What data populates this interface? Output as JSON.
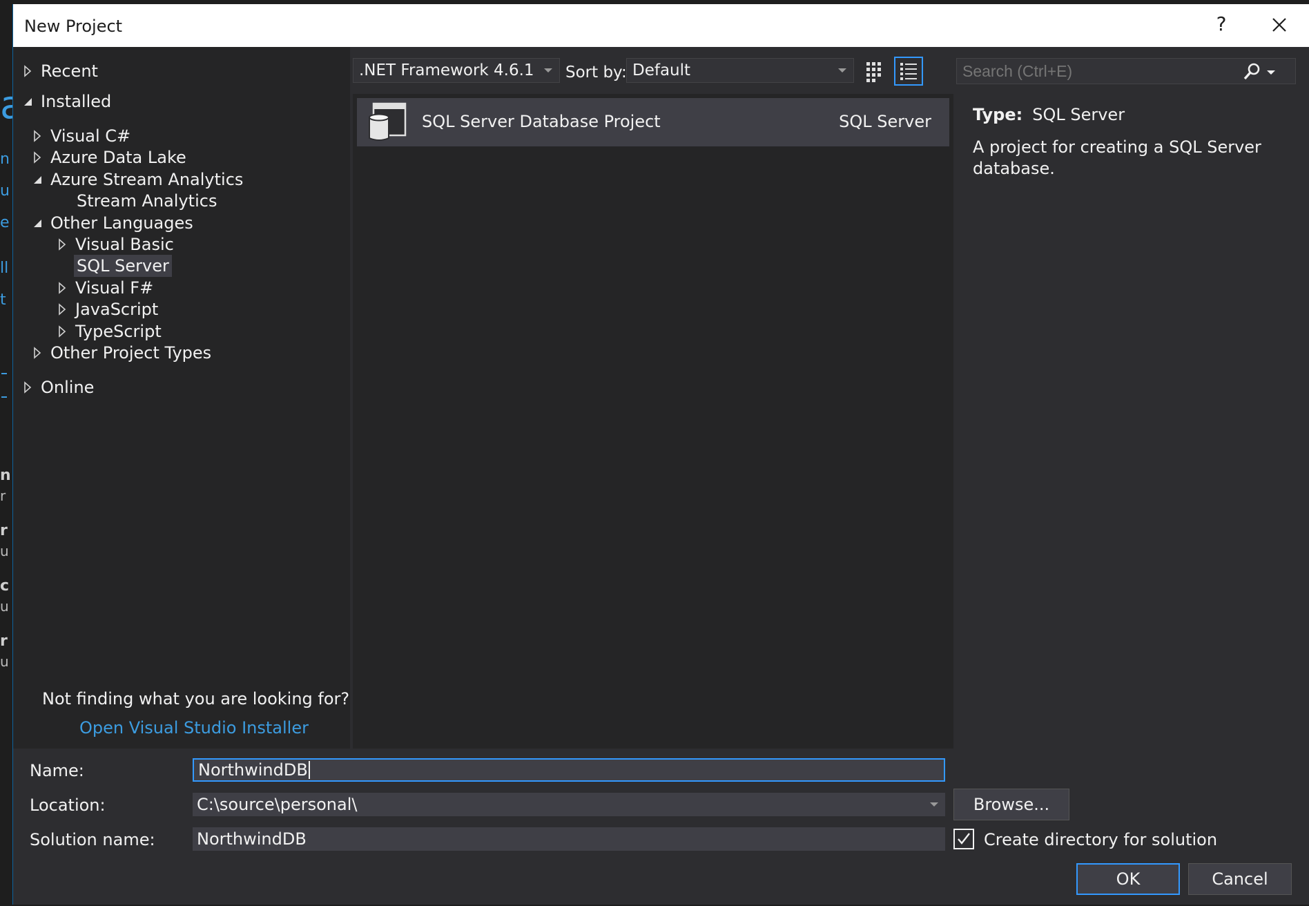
{
  "dialog": {
    "title": "New Project",
    "help_label": "?"
  },
  "tree": {
    "recent": "Recent",
    "installed": "Installed",
    "visual_csharp": "Visual C#",
    "azure_data_lake": "Azure Data Lake",
    "azure_stream_analytics": "Azure Stream Analytics",
    "stream_analytics": "Stream Analytics",
    "other_languages": "Other Languages",
    "visual_basic": "Visual Basic",
    "sql_server": "SQL Server",
    "visual_fsharp": "Visual F#",
    "javascript": "JavaScript",
    "typescript": "TypeScript",
    "other_project_types": "Other Project Types",
    "online": "Online"
  },
  "help_section": {
    "not_finding": "Not finding what you are looking for?",
    "installer_link": "Open Visual Studio Installer"
  },
  "toolbar": {
    "framework": ".NET Framework 4.6.1",
    "sort_by_label": "Sort by:",
    "sort_value": "Default",
    "search_placeholder": "Search (Ctrl+E)"
  },
  "templates": [
    {
      "name": "SQL Server Database Project",
      "language": "SQL Server"
    }
  ],
  "details": {
    "type_label": "Type:",
    "type_value": "SQL Server",
    "description": "A project for creating a SQL Server database."
  },
  "form": {
    "name_label": "Name:",
    "name_value": "NorthwindDB",
    "location_label": "Location:",
    "location_value": "C:\\source\\personal\\",
    "solution_label": "Solution name:",
    "solution_value": "NorthwindDB",
    "browse_label": "Browse...",
    "create_dir_label": "Create directory for solution",
    "create_dir_checked": true,
    "ok_label": "OK",
    "cancel_label": "Cancel"
  },
  "colors": {
    "accent": "#3399ff",
    "link": "#3c9ce0",
    "panel": "#252526",
    "dialog_bg": "#2d2d30",
    "selection": "#3f3f46"
  }
}
